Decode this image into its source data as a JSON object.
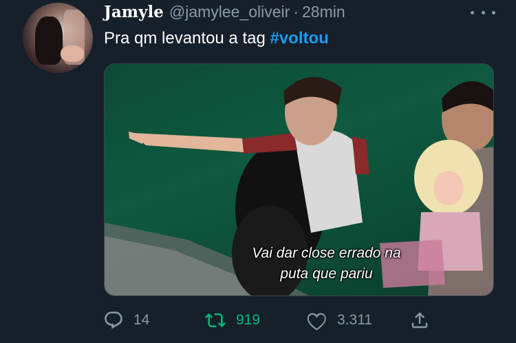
{
  "author": {
    "display_name": "Jamyle",
    "handle": "@jamylee_oliveir",
    "separator": "·",
    "time": "28min"
  },
  "tweet": {
    "text": "Pra qm levantou a tag ",
    "hashtag": "#voltou"
  },
  "media": {
    "caption_line1": "Vai dar close errado na",
    "caption_line2": "puta que pariu"
  },
  "actions": {
    "reply_count": "14",
    "retweet_count": "919",
    "like_count": "3.311"
  },
  "colors": {
    "background": "#15202b",
    "text_primary": "#ffffff",
    "text_secondary": "#8b98a5",
    "hashtag": "#1d9bf0",
    "retweet_active": "#00ba7c"
  },
  "icons": {
    "reply": "reply-icon",
    "retweet": "retweet-icon",
    "like": "heart-icon",
    "share": "share-icon",
    "more": "more-icon"
  }
}
